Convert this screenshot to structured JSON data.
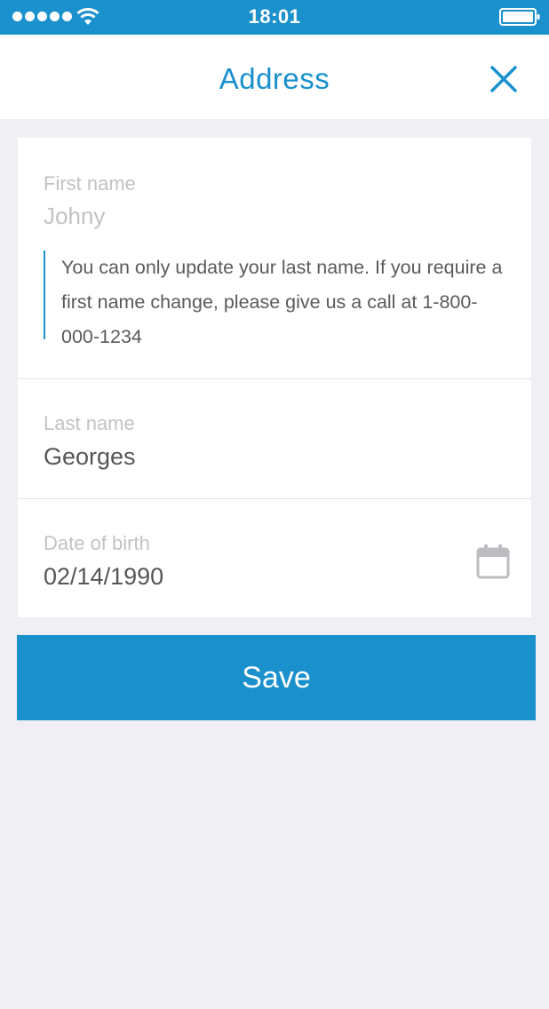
{
  "status_bar": {
    "time": "18:01",
    "signal_icon": "signal-dots-icon",
    "wifi_icon": "wifi-icon",
    "battery_icon": "battery-icon"
  },
  "nav": {
    "title": "Address",
    "close_icon": "close-icon"
  },
  "form": {
    "first_name": {
      "label": "First name",
      "value": "Johny",
      "notice": "You can only update your last name. If you require a first name change, please give us a call at 1-800-000-1234"
    },
    "last_name": {
      "label": "Last name",
      "value": "Georges"
    },
    "date_of_birth": {
      "label": "Date of birth",
      "value": "02/14/1990",
      "icon": "calendar-icon"
    }
  },
  "actions": {
    "save_label": "Save"
  },
  "colors": {
    "accent": "#1a91cd",
    "background": "#efeff4",
    "label_gray": "#c2c2c6",
    "value_gray": "#56565a"
  }
}
